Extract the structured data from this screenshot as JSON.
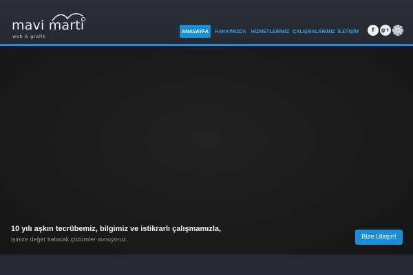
{
  "brand": {
    "logo_text": "mavi marti",
    "logo_sub": "web & grafik"
  },
  "nav": {
    "items": [
      {
        "label": "ANASAYFA",
        "active": true
      },
      {
        "label": "HAKKIMIZDA",
        "active": false
      },
      {
        "label": "HİZMETLERİMİZ",
        "active": false
      },
      {
        "label": "ÇALIŞMALARIMIZ",
        "active": false
      },
      {
        "label": "İLETİŞİM",
        "active": false
      }
    ]
  },
  "social": {
    "facebook_icon": "facebook-icon",
    "googleplus_icon": "google-plus-icon",
    "language_icon": "uk-flag-icon",
    "facebook_glyph": "f",
    "googleplus_glyph": "g+"
  },
  "hero": {
    "title": "10 yılı aşkın tecrübemiz, bilgimiz ve istikrarlı çalışmamızla,",
    "subtitle": "işinize değer katacak çözümler sunuyoruz.",
    "cta_label": "Bize Ulaşın!"
  },
  "colors": {
    "accent": "#1a8fd8",
    "header_bg": "#2a2f38",
    "hero_bg": "#1b1b1b"
  }
}
